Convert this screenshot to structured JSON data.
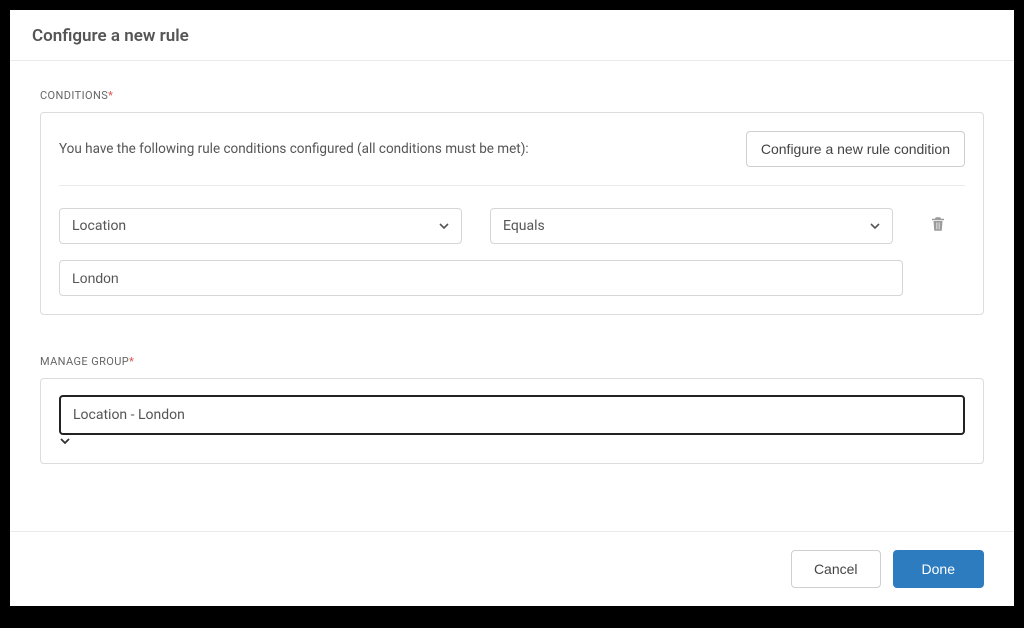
{
  "header": {
    "title": "Configure a new rule"
  },
  "conditions": {
    "label": "CONDITIONS",
    "required_mark": "*",
    "description": "You have the following rule conditions configured (all conditions must be met):",
    "add_button": "Configure a new rule condition",
    "rows": [
      {
        "field": "Location",
        "operator": "Equals",
        "value": "London"
      }
    ]
  },
  "manage_group": {
    "label": "MANAGE GROUP",
    "required_mark": "*",
    "selected": "Location - London"
  },
  "footer": {
    "cancel": "Cancel",
    "done": "Done"
  }
}
